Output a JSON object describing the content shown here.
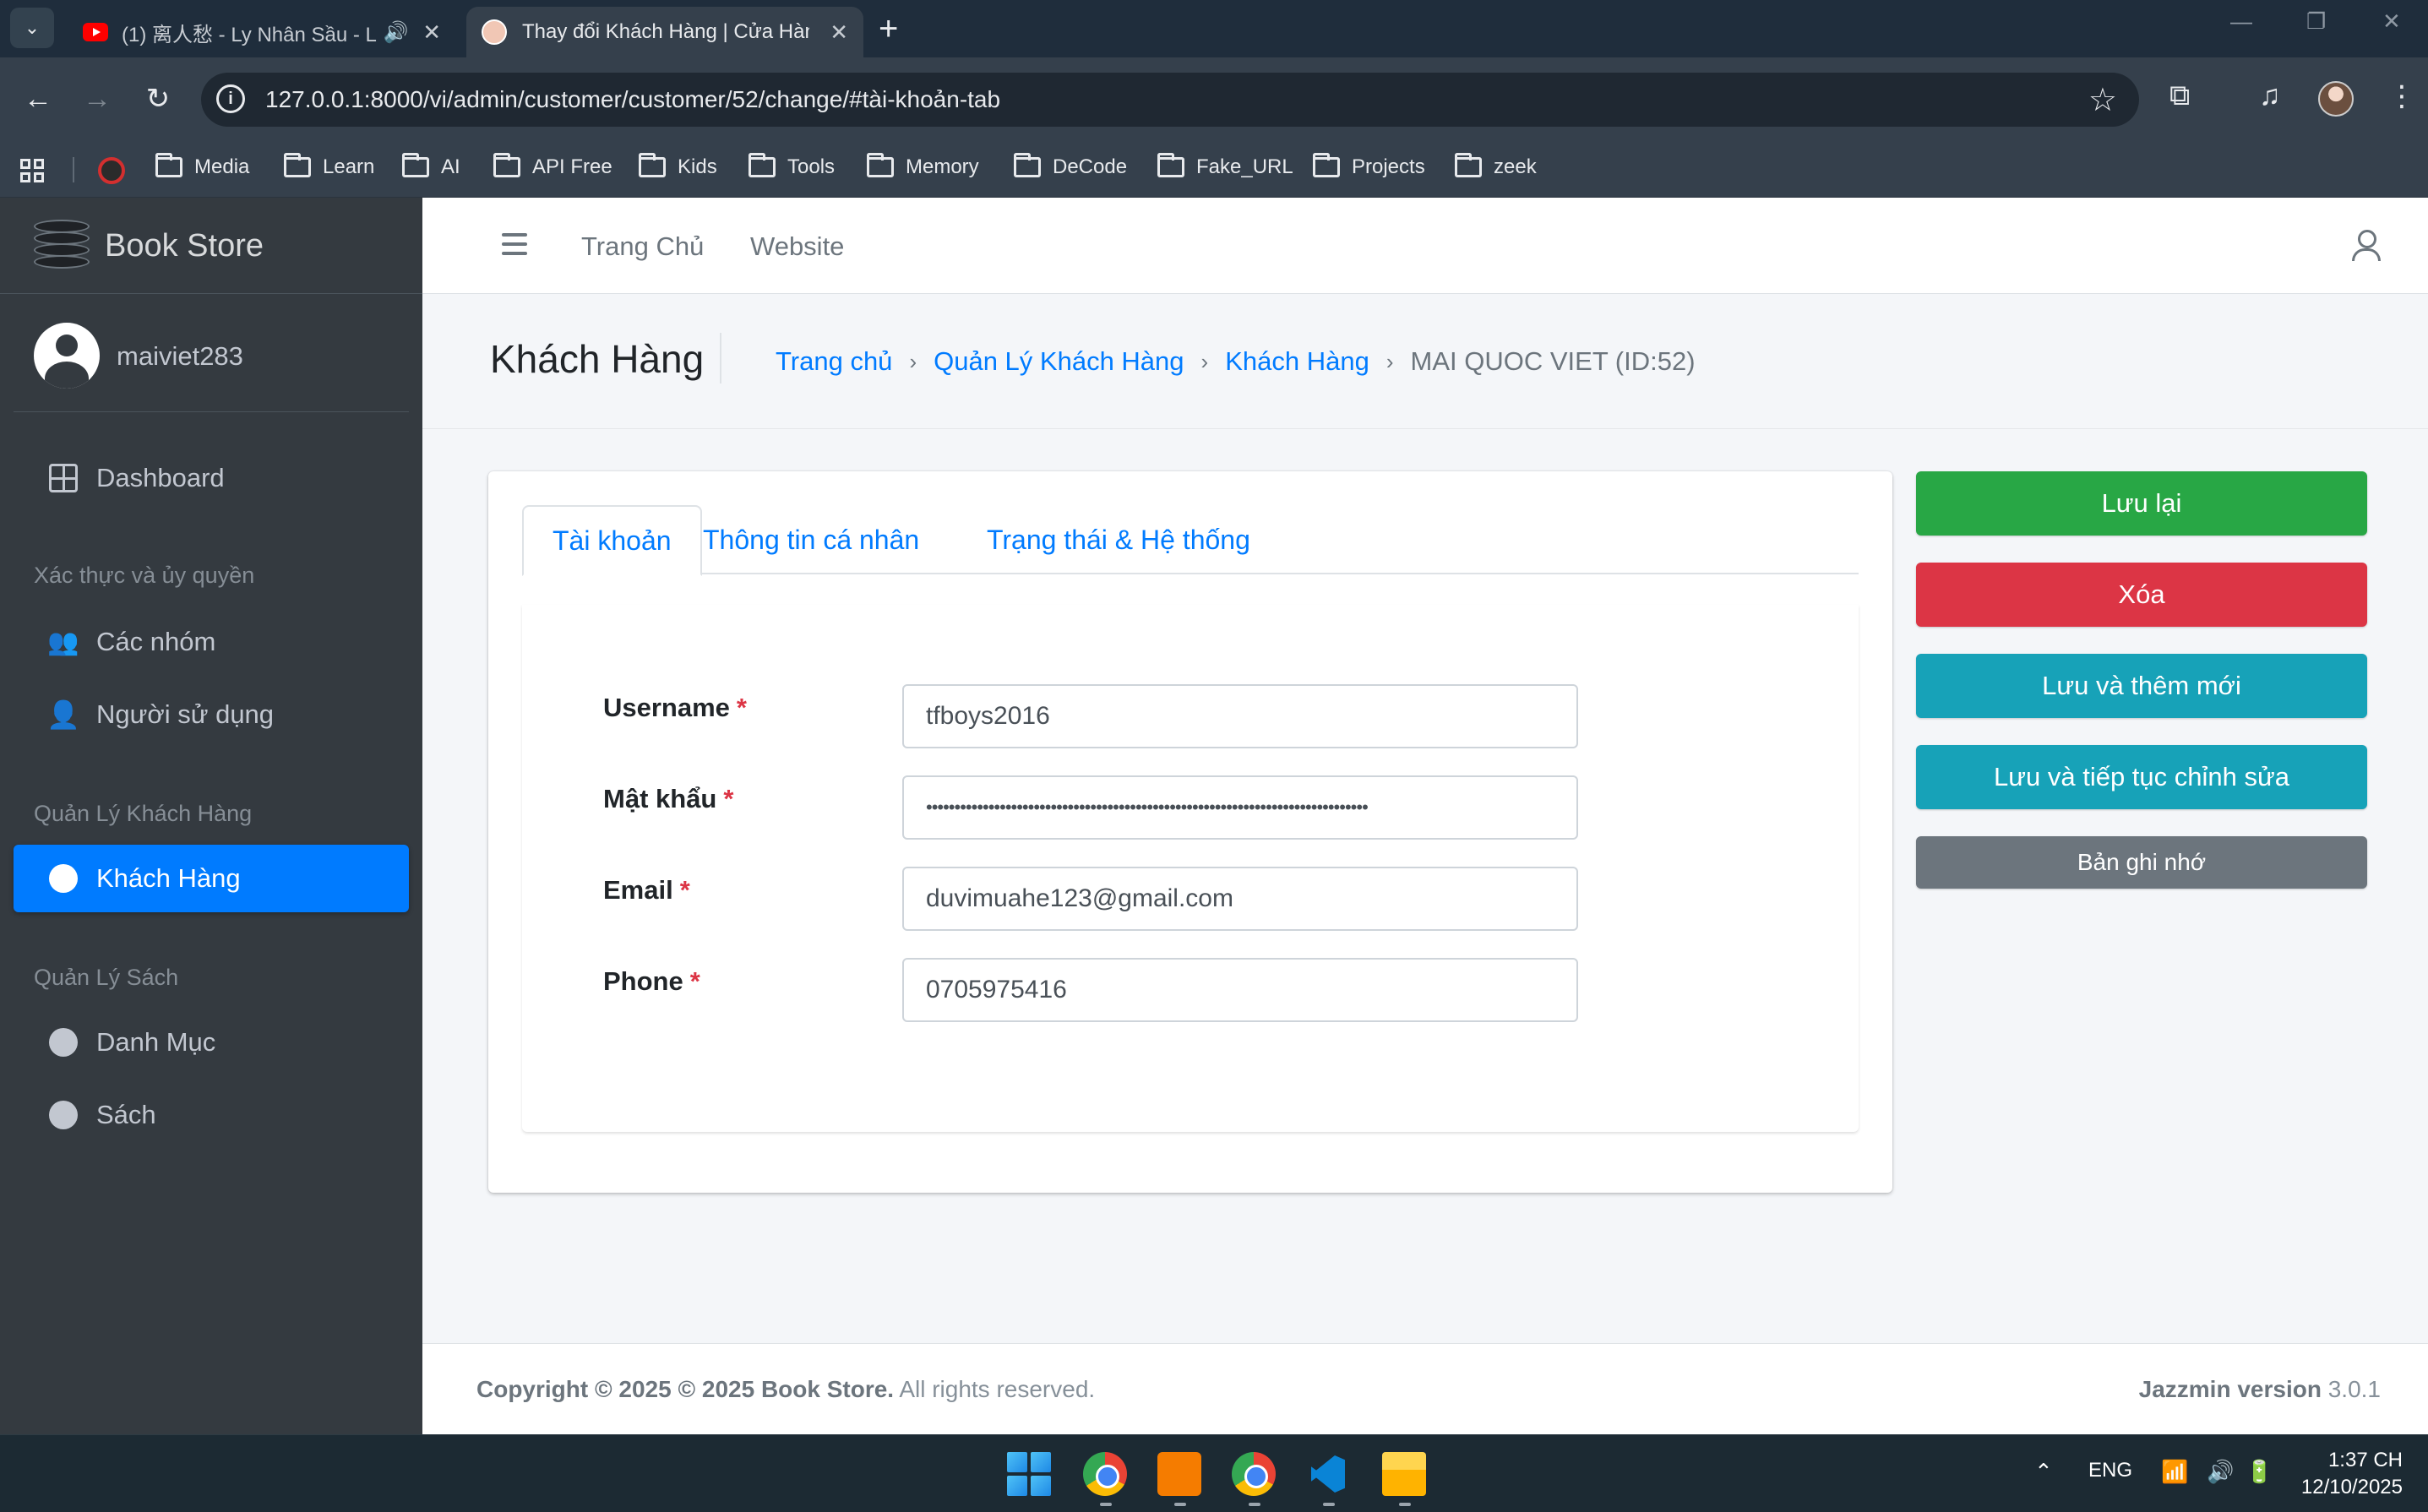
{
  "browser": {
    "tabs": [
      {
        "title": "(1) 离人愁 - Ly Nhân Sầu - L",
        "icon": "youtube-icon",
        "audio": "🔊",
        "close": "✕"
      },
      {
        "title": "Thay đổi Khách Hàng | Cửa Hàn",
        "icon": "site-icon",
        "close": "✕"
      }
    ],
    "tab_menu": "⌄",
    "new_tab": "+",
    "window_controls": {
      "minimize": "—",
      "restore": "❐",
      "close": "✕"
    },
    "nav": {
      "back": "←",
      "forward": "→",
      "reload": "↻"
    },
    "url": "127.0.0.1:8000/vi/admin/customer/customer/52/change/#tài-khoản-tab",
    "star": "☆",
    "extensions": "⧉",
    "media": "♫",
    "menu": "⋮",
    "bookmarks": [
      "Media",
      "Learn",
      "AI",
      "API Free",
      "Kids",
      "Tools",
      "Memory",
      "DeCode",
      "Fake_URL",
      "Projects",
      "zeek"
    ]
  },
  "sidebar": {
    "brand": "Book Store",
    "user": "maiviet283",
    "dashboard": "Dashboard",
    "groups": [
      {
        "header": "Xác thực và ủy quyền",
        "items": [
          "Các nhóm",
          "Người sử dụng"
        ]
      },
      {
        "header": "Quản Lý Khách Hàng",
        "items": [
          "Khách Hàng"
        ]
      },
      {
        "header": "Quản Lý Sách",
        "items": [
          "Danh Mục",
          "Sách"
        ]
      }
    ]
  },
  "topnav": {
    "home": "Trang Chủ",
    "website": "Website"
  },
  "page": {
    "title": "Khách Hàng",
    "breadcrumb": [
      "Trang chủ",
      "Quản Lý Khách Hàng",
      "Khách Hàng"
    ],
    "breadcrumb_current": "MAI QUOC VIET (ID:52)",
    "breadcrumb_sep": "›"
  },
  "form": {
    "tabs": [
      "Tài khoản",
      "Thông tin cá nhân",
      "Trạng thái & Hệ thống"
    ],
    "required_mark": "*",
    "fields": {
      "username": {
        "label": "Username",
        "value": "tfboys2016"
      },
      "password": {
        "label": "Mật khẩu",
        "value": "••••••••••••••••••••••••••••••••••••••••••••••••••••••••••••••••••••••••••••••"
      },
      "email": {
        "label": "Email",
        "value": "duvimuahe123@gmail.com"
      },
      "phone": {
        "label": "Phone",
        "value": "0705975416"
      }
    }
  },
  "actions": {
    "save": "Lưu lại",
    "delete": "Xóa",
    "save_add": "Lưu và thêm mới",
    "save_continue": "Lưu và tiếp tục chỉnh sửa",
    "history": "Bản ghi nhớ"
  },
  "footer": {
    "copyright_bold": "Copyright © 2025 © 2025 Book Store.",
    "copyright_rest": " All rights reserved.",
    "version_label": "Jazzmin version",
    "version": " 3.0.1"
  },
  "taskbar": {
    "tray_chevron": "⌃",
    "language": "ENG",
    "time": "1:37 CH",
    "date": "12/10/2025"
  },
  "colors": {
    "primary": "#007bff",
    "success": "#28a745",
    "danger": "#dc3545",
    "info": "#17a2b8",
    "secondary": "#6c757d",
    "sidebar": "#343a40"
  }
}
